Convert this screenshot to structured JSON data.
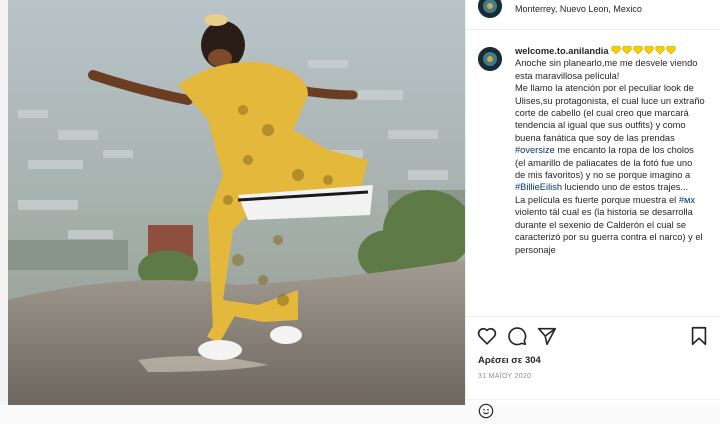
{
  "header": {
    "location": "Monterrey, Nuevo Leon, Mexico"
  },
  "caption": {
    "username": "welcome.to.anilandia",
    "line1": "Anoche sin planearlo,me me desvele viendo esta maravillosa película!",
    "line2a": "Me llamo la atención por el peculiar look de Ulises,su protagonista, el cual luce un extraño corte de cabello (el cual creo que marcará tendencia al igual que sus outfits) y como buena fanática que soy de las prendas ",
    "tag_oversize": "#oversize",
    "line2b": " me encanto la ropa de los cholos (el amarillo de paliacates de la fotó fue uno de mis favoritos) y no se porque imagino a ",
    "tag_billie": "#BillieEilish",
    "line2c": " luciendo uno de estos trajes...",
    "line3a": "La película es fuerte porque muestra el ",
    "tag_mx": "#мх",
    "line3b": " violento tál cual es (la historia se desarrolla durante el sexenio de Calderón el cual se caracterizó por su guerra contra el narco) y el personaje"
  },
  "footer": {
    "likes": "Αρέσει σε 304",
    "date": "31 ΜΑΪΟΥ 2020"
  },
  "colors": {
    "heart_emoji": "#f5d000",
    "link": "#00376b"
  }
}
